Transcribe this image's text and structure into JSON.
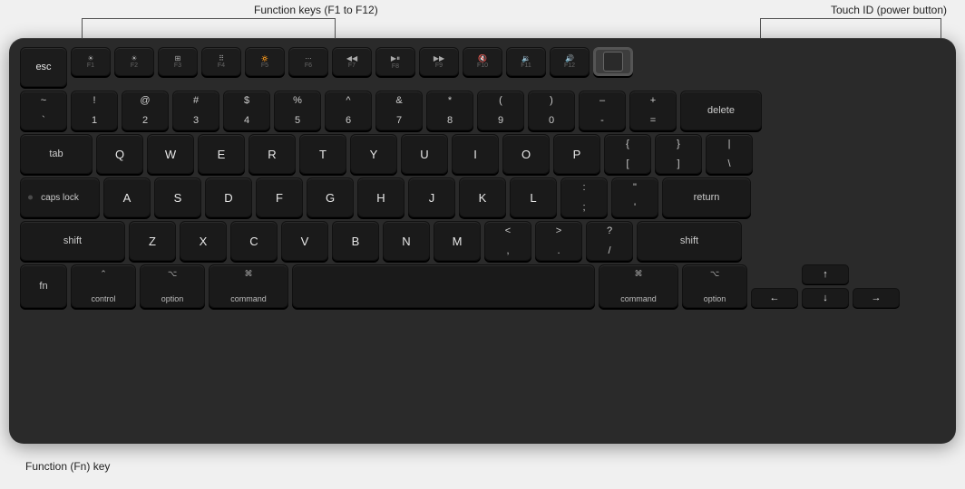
{
  "annotations": {
    "function_keys_label": "Function keys (F1 to F12)",
    "touchid_label": "Touch ID (power button)",
    "fn_key_label": "Function (Fn) key"
  },
  "keyboard": {
    "rows": {
      "fn_row": [
        "esc",
        "F1",
        "F2",
        "F3",
        "F4",
        "F5",
        "F6",
        "F7",
        "F8",
        "F9",
        "F10",
        "F11",
        "F12"
      ],
      "row1": [
        "~`",
        "!1",
        "@2",
        "#3",
        "$4",
        "%5",
        "^6",
        "&7",
        "*8",
        "(9",
        ")0",
        "—-",
        "+=",
        "delete"
      ],
      "row2": [
        "tab",
        "Q",
        "W",
        "E",
        "R",
        "T",
        "Y",
        "U",
        "I",
        "O",
        "P",
        "{[",
        "}]",
        "|\\"
      ],
      "row3": [
        "caps lock",
        "A",
        "S",
        "D",
        "F",
        "G",
        "H",
        "J",
        "K",
        "L",
        ";:",
        "\"'",
        "return"
      ],
      "row4": [
        "shift",
        "Z",
        "X",
        "C",
        "V",
        "B",
        "N",
        "M",
        "<,",
        ">.",
        "/?",
        "shift"
      ],
      "row5": [
        "fn",
        "control",
        "option",
        "command",
        "",
        "command",
        "option",
        "←",
        "↑↓",
        "→"
      ]
    }
  }
}
